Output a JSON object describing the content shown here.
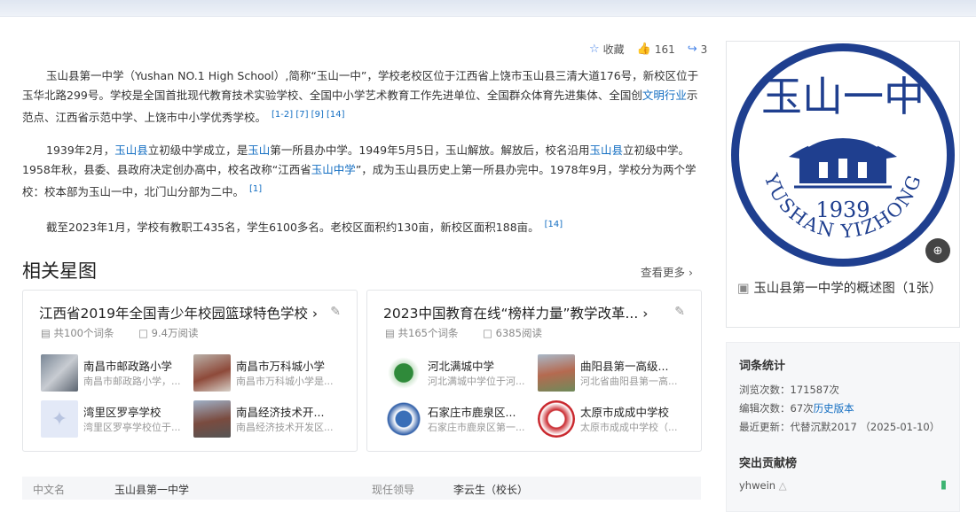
{
  "actions": {
    "collect_label": "收藏",
    "like_count": "161",
    "share_count": "3"
  },
  "paragraphs": {
    "p1": "玉山县第一中学（Yushan NO.1 High School）,简称“玉山一中”，学校老校区位于江西省上饶市玉山县三清大道176号，新校区位于玉华北路299号。学校是全国首批现代教育技术实验学校、全国中小学艺术教育工作先进单位、全国群众体育先进集体、全国创",
    "p1_link": "文明行业",
    "p1_tail": "示范点、江西省示范中学、上饶市中小学优秀学校。",
    "p1_refs": "[1-2] [7] [9] [14]",
    "p2a": "1939年2月，",
    "p2_link1": "玉山县",
    "p2b": "立初级中学成立，是",
    "p2_link2": "玉山",
    "p2c": "第一所县办中学。1949年5月5日，玉山解放。解放后，校名沿用",
    "p2_link3": "玉山县",
    "p2d": "立初级中学。1958年秋，县委、县政府决定创办高中，校名改称“江西省",
    "p2_link4": "玉山中学",
    "p2e": "”，成为玉山县历史上第一所县办完中。1978年9月，学校分为两个学校：校本部为玉山一中，北门山分部为二中。",
    "p2_ref": "[1]",
    "p3": "截至2023年1月，学校有教职工435名，学生6100多名。老校区面积约130亩，新校区面积188亩。",
    "p3_ref": "[14]"
  },
  "related": {
    "title": "相关星图",
    "more": "查看更多",
    "cards": [
      {
        "title": "江西省2019年全国青少年校园篮球特色学校",
        "count": "共100个词条",
        "reads": "9.4万阅读",
        "items": [
          {
            "name": "南昌市邮政路小学",
            "desc": "南昌市邮政路小学，..."
          },
          {
            "name": "南昌市万科城小学",
            "desc": "南昌市万科城小学是..."
          },
          {
            "name": "湾里区罗亭学校",
            "desc": "湾里区罗亭学校位于..."
          },
          {
            "name": "南昌经济技术开...",
            "desc": "南昌经济技术开发区..."
          }
        ]
      },
      {
        "title": "2023中国教育在线“榜样力量”教学改革...",
        "count": "共165个词条",
        "reads": "6385阅读",
        "items": [
          {
            "name": "河北满城中学",
            "desc": "河北满城中学位于河..."
          },
          {
            "name": "曲阳县第一高级...",
            "desc": "河北省曲阳县第一高..."
          },
          {
            "name": "石家庄市鹿泉区...",
            "desc": "石家庄市鹿泉区第一..."
          },
          {
            "name": "太原市成成中学校",
            "desc": "太原市成成中学校（..."
          }
        ]
      }
    ]
  },
  "logo": {
    "top_text": "玉山一中",
    "year": "1939",
    "bottom_text": "YUSHAN YIZHONG",
    "caption": "玉山县第一中学的概述图（1张）"
  },
  "stats": {
    "title": "词条统计",
    "views_label": "浏览次数：",
    "views": "171587次",
    "edits_label": "编辑次数：",
    "edits": "67次",
    "history_link": "历史版本",
    "updated_label": "最近更新：",
    "updated": "代替沉默2017 （2025-01-10）",
    "contrib_title": "突出贡献榜",
    "contributor": "yhwein"
  },
  "infobox": {
    "cn_name_label": "中文名",
    "cn_name": "玉山县第一中学",
    "leader_label": "现任领导",
    "leader": "李云生（校长）"
  },
  "colors": {
    "link": "#136ec2",
    "logo_blue": "#1f3f8f"
  }
}
